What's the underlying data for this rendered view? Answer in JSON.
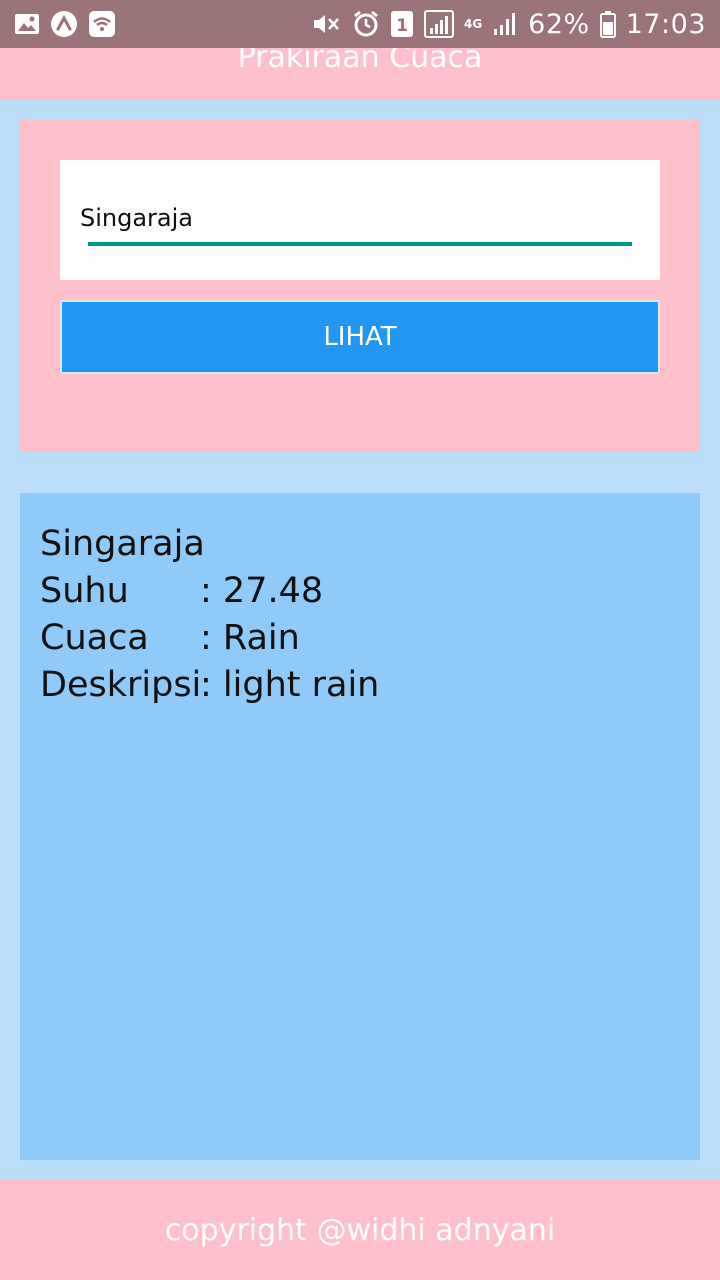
{
  "status_bar": {
    "battery_percent": "62%",
    "time": "17:03",
    "notification_count": "1",
    "network_type": "4G",
    "icons": [
      "gallery-icon",
      "app-icon",
      "wifi-icon",
      "mute-icon",
      "alarm-icon",
      "sim-icon",
      "signal-icon",
      "battery-icon"
    ]
  },
  "app_bar": {
    "title": "Prakiraan Cuaca"
  },
  "form": {
    "city_value": "Singaraja",
    "button_label": "LIHAT"
  },
  "result": {
    "city": "Singaraja",
    "rows": [
      {
        "label": "Suhu",
        "sep": ": ",
        "value": "27.48"
      },
      {
        "label": "Cuaca",
        "sep": ": ",
        "value": "Rain"
      },
      {
        "label": "Deskripsi",
        "sep": ": ",
        "value": "light rain"
      }
    ]
  },
  "footer": {
    "text": "copyright @widhi adnyani"
  },
  "colors": {
    "pink": "#ffc0cb",
    "light_blue": "#bbdefb",
    "card_blue": "#90caf9",
    "button_blue": "#2196f3",
    "underline_teal": "#00968a",
    "status_bar": "#9a7479"
  }
}
